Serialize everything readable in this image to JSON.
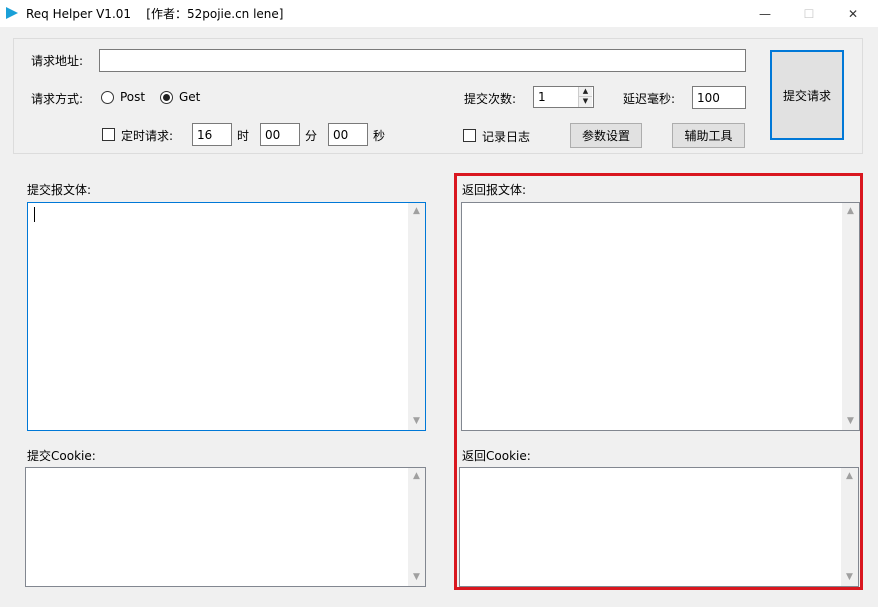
{
  "window": {
    "title": "Req Helper V1.01    [作者：52pojie.cn lene]",
    "controls": {
      "minimize": "—",
      "maximize": "☐",
      "close": "✕"
    }
  },
  "request": {
    "url_label": "请求地址:",
    "url_value": "",
    "method_label": "请求方式:",
    "method_post": "Post",
    "method_get": "Get",
    "method_selected": "Get",
    "submit_count_label": "提交次数:",
    "submit_count_value": "1",
    "delay_label": "延迟毫秒:",
    "delay_value": "100",
    "submit_button": "提交请求"
  },
  "schedule": {
    "enabled": false,
    "label": "定时请求:",
    "hour": "16",
    "hour_unit": "时",
    "minute": "00",
    "minute_unit": "分",
    "second": "00",
    "second_unit": "秒"
  },
  "log": {
    "enabled": false,
    "label": "记录日志"
  },
  "buttons": {
    "params": "参数设置",
    "tools": "辅助工具"
  },
  "panes": {
    "submit_body_label": "提交报文体:",
    "submit_body_value": "",
    "return_body_label": "返回报文体:",
    "return_body_value": "",
    "submit_cookie_label": "提交Cookie:",
    "submit_cookie_value": "",
    "return_cookie_label": "返回Cookie:",
    "return_cookie_value": ""
  },
  "colors": {
    "accent": "#0078d7",
    "highlight": "#d9171f",
    "app_icon": "#1aa0d8"
  }
}
